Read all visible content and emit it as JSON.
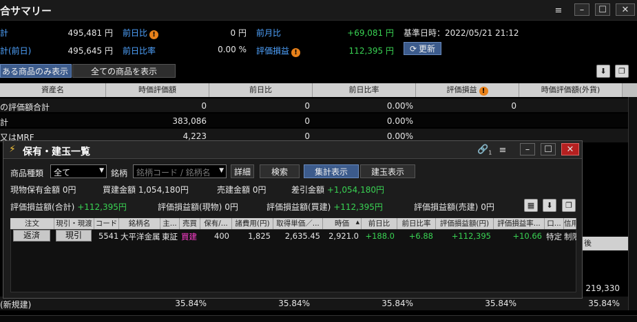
{
  "main_window": {
    "title": "合サマリー"
  },
  "summary": {
    "r1": {
      "label1": "計",
      "value1": "495,481 円",
      "label2": "前日比",
      "value2": "0 円",
      "label3": "前月比",
      "value3": "+69,081 円",
      "base_time": "基準日時：2022/05/21 21:12"
    },
    "r2": {
      "label1": "計(前日)",
      "value1": "495,645 円",
      "label2": "前日比率",
      "value2": "0.00 %",
      "label3": "評価損益",
      "value3": "112,395 円",
      "refresh": "更新"
    }
  },
  "filter": {
    "tab1": "ある商品のみ表示",
    "tab2": "全ての商品を表示"
  },
  "main_table": {
    "headers": [
      "資産名",
      "時価評価額",
      "前日比",
      "前日比率",
      "評価損益",
      "時価評価額(外貨)"
    ],
    "rows": [
      {
        "name": "の評価額合計",
        "mv": "0",
        "chg": "0",
        "pct": "0.00%",
        "pl": "0"
      },
      {
        "name": "計",
        "mv": "383,086",
        "chg": "0",
        "pct": "0.00%"
      },
      {
        "name": "又はMRF",
        "mv": "4,223",
        "chg": "0",
        "pct": "0.00%"
      }
    ],
    "partial": {
      "header": "後",
      "value": "219,330"
    },
    "bottom": {
      "name": "(新規建)",
      "v1": "35.84%",
      "v2": "35.84%",
      "v3": "35.84%",
      "v4": "35.84%",
      "v5": "35.84%"
    }
  },
  "sub_window": {
    "title": "保有・建玉一覧",
    "link_count": "1",
    "filter": {
      "type_label": "商品種類",
      "type_value": "全て",
      "symbol_label": "銘柄",
      "symbol_placeholder": "銘柄コード / 銘柄名",
      "detail": "詳細",
      "search": "検索",
      "sum_view": "集計表示",
      "pos_view": "建玉表示"
    },
    "stats1": [
      {
        "label": "現物保有金額",
        "value": "0円"
      },
      {
        "label": "買建金額",
        "value": "1,054,180円"
      },
      {
        "label": "売建金額",
        "value": "0円"
      },
      {
        "label": "差引金額",
        "value": "+1,054,180円"
      }
    ],
    "stats2": [
      {
        "label": "評価損益額(合計)",
        "value": "+112,395円"
      },
      {
        "label": "評価損益額(現物)",
        "value": "0円"
      },
      {
        "label": "評価損益額(買建)",
        "value": "+112,395円"
      },
      {
        "label": "評価損益額(売建)",
        "value": "0円"
      }
    ],
    "table": {
      "headers": [
        "注文",
        "現引・現渡",
        "コード",
        "銘柄名",
        "主...",
        "売買",
        "保有/...",
        "諸費用(円)",
        "取得単価／...",
        "時価",
        "前日比",
        "前日比率",
        "評価損益額(円)",
        "評価損益率...",
        "口...",
        "信用"
      ],
      "row": {
        "order": "返済",
        "action": "現引",
        "code": "5541",
        "name": "大平洋金属",
        "market": "東証",
        "side": "買建",
        "qty": "400",
        "fee": "1,825",
        "cost": "2,635.45",
        "price": "2,921.0",
        "chg": "+188.0",
        "pct": "+6.88",
        "pl": "+112,395",
        "plr": "+10.66",
        "acct": "特定",
        "credit": "制限"
      }
    }
  },
  "colors": {
    "accent_green": "#39d353",
    "warn_orange": "#e8811a",
    "buy_magenta": "#ff3ecf",
    "tab_blue": "#3c5b8c"
  }
}
